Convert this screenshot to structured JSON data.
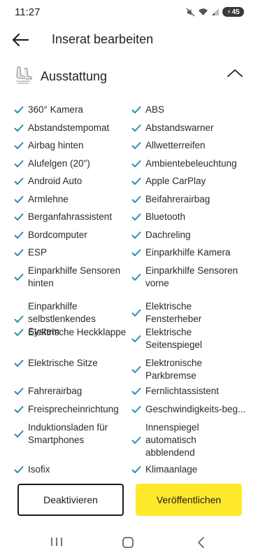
{
  "status": {
    "time": "11:27",
    "battery": "45"
  },
  "header": {
    "title": "Inserat bearbeiten",
    "back_icon": "arrow-left-icon"
  },
  "section": {
    "title": "Ausstattung",
    "icon": "car-seat-icon",
    "collapse_icon": "chevron-up-icon"
  },
  "features": [
    {
      "left": [
        "360° Kamera"
      ],
      "right": [
        "ABS"
      ]
    },
    {
      "left": [
        "Abstandstempomat"
      ],
      "right": [
        "Abstandswarner"
      ]
    },
    {
      "left": [
        "Airbag hinten"
      ],
      "right": [
        "Allwetterreifen"
      ]
    },
    {
      "left": [
        "Alufelgen (20\")"
      ],
      "right": [
        "Ambientebeleuchtung"
      ]
    },
    {
      "left": [
        "Android Auto"
      ],
      "right": [
        "Apple CarPlay"
      ]
    },
    {
      "left": [
        "Armlehne"
      ],
      "right": [
        "Beifahrerairbag"
      ]
    },
    {
      "left": [
        "Berganfahrassistent"
      ],
      "right": [
        "Bluetooth"
      ]
    },
    {
      "left": [
        "Bordcomputer"
      ],
      "right": [
        "Dachreling"
      ]
    },
    {
      "left": [
        "ESP"
      ],
      "right": [
        "Einparkhilfe Kamera"
      ]
    },
    {
      "left": [
        "Einparkhilfe Sensoren",
        "hinten"
      ],
      "right": [
        "Einparkhilfe Sensoren",
        "vorne"
      ]
    },
    {
      "left": [
        "Einparkhilfe",
        "selbstlenkendes System"
      ],
      "right": [
        "Elektrische",
        "Fensterheber"
      ]
    },
    {
      "left": [
        "Elektrische Heckklappe"
      ],
      "right": [
        "Elektrische",
        "Seitenspiegel"
      ]
    },
    {
      "left": [
        "Elektrische Sitze"
      ],
      "right": [
        "Elektronische",
        "Parkbremse"
      ]
    },
    {
      "left": [
        "Fahrerairbag"
      ],
      "right": [
        "Fernlichtassistent"
      ]
    },
    {
      "left": [
        "Freisprecheinrichtung"
      ],
      "right": [
        "Geschwindigkeits-beg..."
      ]
    },
    {
      "left": [
        "Induktionsladen für",
        "Smartphones"
      ],
      "right": [
        "Innenspiegel",
        "automatisch",
        "abblendend"
      ]
    },
    {
      "left": [
        "Isofix"
      ],
      "right": [
        "Klimaanlage"
      ]
    }
  ],
  "footer": {
    "deactivate_label": "Deaktivieren",
    "publish_label": "Veröffentlichen"
  },
  "colors": {
    "check": "#2a8fa8",
    "publish_button": "#ffe92d"
  },
  "nav": {
    "recents_icon": "recents-icon",
    "home_icon": "home-icon",
    "back_icon": "nav-back-icon"
  }
}
